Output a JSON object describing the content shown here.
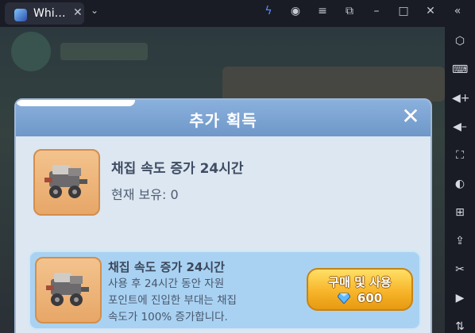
{
  "tab": {
    "title": "Whi…"
  },
  "dialog": {
    "title": "추가 획득",
    "owned_item": {
      "name": "채집 속도 증가 24시간",
      "owned_label": "현재 보유: 0"
    },
    "offer_item": {
      "name": "채집 속도 증가 24시간",
      "desc_line1": "사용 후 24시간 동안 자원",
      "desc_line2": "포인트에 진입한 부대는 채집",
      "desc_line3": "속도가 100% 증가합니다.",
      "buy_label": "구매 및 사용",
      "price": "600"
    }
  },
  "colors": {
    "accent_header": "#7aa4d6",
    "buy_button": "#f7b52a",
    "dialog_bg": "#dce7f1",
    "offer_card": "#a9d2f2"
  }
}
